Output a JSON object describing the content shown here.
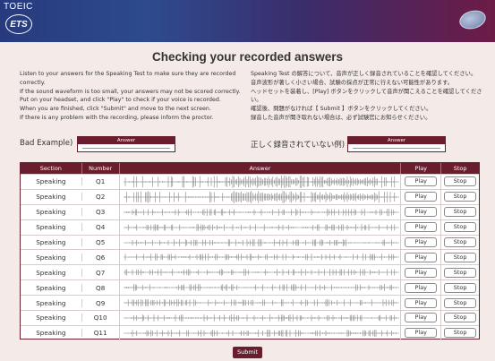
{
  "header": {
    "brand": "TOEIC",
    "logo": "ETS"
  },
  "page_title": "Checking your recorded answers",
  "instructions": {
    "en": [
      "Listen to your answers for the Speaking Test to make sure they are recorded correctly.",
      "If the sound waveform is too small, your answers may not be scored correctly.",
      "Put on your headset, and click \"Play\" to check if your voice is recorded.",
      "When you are finished, click \"Submit\" and move to the next screen.",
      "If there is any problem with the recording, please inform the proctor."
    ],
    "ja": [
      "Speaking Test の解答について、音声が正しく録音されていることを確認してください。",
      "音声波形が著しく小さい場合、試験の採点が正常に行えない可能性があります。",
      "ヘッドセットを装着し、[Play] ボタンをクリックして音声が聞こえることを確認してください。",
      "確認後、問題がなければ【 Submit 】ボタンをクリックしてください。",
      "録音した音声が聞き取れない場合は、必ず試験官にお知らせください。"
    ]
  },
  "bad_example": {
    "label": "Bad Example)",
    "box_header": "Answer"
  },
  "bad_example_ja": {
    "label": "正しく録音されていない例)",
    "box_header": "Answer"
  },
  "table": {
    "headers": {
      "section": "Section",
      "number": "Number",
      "answer": "Answer",
      "play": "Play",
      "stop": "Stop"
    },
    "rows": [
      {
        "section": "Speaking",
        "number": "Q1",
        "play": "Play",
        "stop": "Stop"
      },
      {
        "section": "Speaking",
        "number": "Q2",
        "play": "Play",
        "stop": "Stop"
      },
      {
        "section": "Speaking",
        "number": "Q3",
        "play": "Play",
        "stop": "Stop"
      },
      {
        "section": "Speaking",
        "number": "Q4",
        "play": "Play",
        "stop": "Stop"
      },
      {
        "section": "Speaking",
        "number": "Q5",
        "play": "Play",
        "stop": "Stop"
      },
      {
        "section": "Speaking",
        "number": "Q6",
        "play": "Play",
        "stop": "Stop"
      },
      {
        "section": "Speaking",
        "number": "Q7",
        "play": "Play",
        "stop": "Stop"
      },
      {
        "section": "Speaking",
        "number": "Q8",
        "play": "Play",
        "stop": "Stop"
      },
      {
        "section": "Speaking",
        "number": "Q9",
        "play": "Play",
        "stop": "Stop"
      },
      {
        "section": "Speaking",
        "number": "Q10",
        "play": "Play",
        "stop": "Stop"
      },
      {
        "section": "Speaking",
        "number": "Q11",
        "play": "Play",
        "stop": "Stop"
      }
    ]
  },
  "submit_label": "Submit",
  "colors": {
    "accent": "#6a1d2c",
    "header_left": "#273a7d",
    "header_right": "#6d1b46",
    "background": "#f4ebe8"
  }
}
